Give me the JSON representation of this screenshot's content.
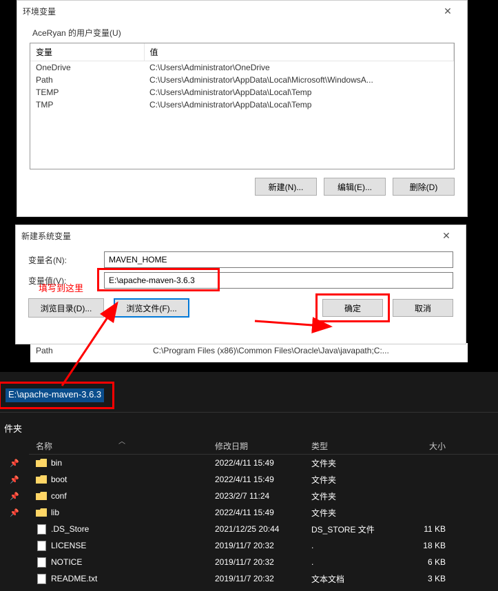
{
  "env_dialog": {
    "title": "环境变量",
    "group_label": "AceRyan 的用户变量(U)",
    "columns": {
      "var": "变量",
      "val": "值"
    },
    "rows": [
      {
        "var": "OneDrive",
        "val": "C:\\Users\\Administrator\\OneDrive"
      },
      {
        "var": "Path",
        "val": "C:\\Users\\Administrator\\AppData\\Local\\Microsoft\\WindowsA..."
      },
      {
        "var": "TEMP",
        "val": "C:\\Users\\Administrator\\AppData\\Local\\Temp"
      },
      {
        "var": "TMP",
        "val": "C:\\Users\\Administrator\\AppData\\Local\\Temp"
      }
    ],
    "buttons": {
      "new": "新建(N)...",
      "edit": "编辑(E)...",
      "delete": "删除(D)"
    }
  },
  "sys_strip": {
    "path_var": "Path",
    "path_val": "C:\\Program Files (x86)\\Common Files\\Oracle\\Java\\javapath;C:..."
  },
  "new_dialog": {
    "title": "新建系统变量",
    "name_label": "变量名(N):",
    "name_value": "MAVEN_HOME",
    "value_label": "变量值(V):",
    "value_value": "E:\\apache-maven-3.6.3",
    "annotation": "填写到这里",
    "buttons": {
      "browse_dir": "浏览目录(D)...",
      "browse_file": "浏览文件(F)...",
      "ok": "确定",
      "cancel": "取消"
    }
  },
  "explorer": {
    "address": "E:\\apache-maven-3.6.3",
    "group_label": "件夹",
    "columns": {
      "name": "名称",
      "date": "修改日期",
      "type": "类型",
      "size": "大小"
    },
    "rows": [
      {
        "pin": true,
        "icon": "folder",
        "name": "bin",
        "date": "2022/4/11 15:49",
        "type": "文件夹",
        "size": ""
      },
      {
        "pin": true,
        "icon": "folder",
        "name": "boot",
        "date": "2022/4/11 15:49",
        "type": "文件夹",
        "size": ""
      },
      {
        "pin": true,
        "icon": "folder",
        "name": "conf",
        "date": "2023/2/7 11:24",
        "type": "文件夹",
        "size": ""
      },
      {
        "pin": true,
        "icon": "folder",
        "name": "lib",
        "date": "2022/4/11 15:49",
        "type": "文件夹",
        "size": ""
      },
      {
        "pin": false,
        "icon": "file",
        "name": ".DS_Store",
        "date": "2021/12/25 20:44",
        "type": "DS_STORE 文件",
        "size": "11 KB"
      },
      {
        "pin": false,
        "icon": "file",
        "name": "LICENSE",
        "date": "2019/11/7 20:32",
        "type": ".",
        "size": "18 KB"
      },
      {
        "pin": false,
        "icon": "file",
        "name": "NOTICE",
        "date": "2019/11/7 20:32",
        "type": ".",
        "size": "6 KB"
      },
      {
        "pin": false,
        "icon": "file",
        "name": "README.txt",
        "date": "2019/11/7 20:32",
        "type": "文本文档",
        "size": "3 KB"
      }
    ]
  }
}
